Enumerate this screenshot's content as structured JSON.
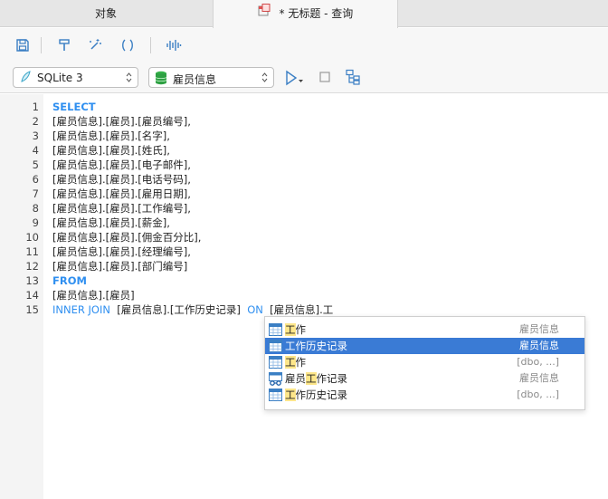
{
  "tabs": {
    "objects": "对象",
    "query": "* 无标题 - 查询"
  },
  "connection": {
    "database": "SQLite 3",
    "schema": "雇员信息"
  },
  "editor": {
    "lines": [
      {
        "n": "1",
        "parts": [
          {
            "t": "SELECT",
            "c": "kw"
          }
        ]
      },
      {
        "n": "2",
        "parts": [
          {
            "t": "[雇员信息].[雇员].[雇员编号],",
            "c": ""
          }
        ]
      },
      {
        "n": "3",
        "parts": [
          {
            "t": "[雇员信息].[雇员].[名字],",
            "c": ""
          }
        ]
      },
      {
        "n": "4",
        "parts": [
          {
            "t": "[雇员信息].[雇员].[姓氏],",
            "c": ""
          }
        ]
      },
      {
        "n": "5",
        "parts": [
          {
            "t": "[雇员信息].[雇员].[电子邮件],",
            "c": ""
          }
        ]
      },
      {
        "n": "6",
        "parts": [
          {
            "t": "[雇员信息].[雇员].[电话号码],",
            "c": ""
          }
        ]
      },
      {
        "n": "7",
        "parts": [
          {
            "t": "[雇员信息].[雇员].[雇用日期],",
            "c": ""
          }
        ]
      },
      {
        "n": "8",
        "parts": [
          {
            "t": "[雇员信息].[雇员].[工作编号],",
            "c": ""
          }
        ]
      },
      {
        "n": "9",
        "parts": [
          {
            "t": "[雇员信息].[雇员].[薪金],",
            "c": ""
          }
        ]
      },
      {
        "n": "10",
        "parts": [
          {
            "t": "[雇员信息].[雇员].[佣金百分比],",
            "c": ""
          }
        ]
      },
      {
        "n": "11",
        "parts": [
          {
            "t": "[雇员信息].[雇员].[经理编号],",
            "c": ""
          }
        ]
      },
      {
        "n": "12",
        "parts": [
          {
            "t": "[雇员信息].[雇员].[部门编号]",
            "c": ""
          }
        ]
      },
      {
        "n": "13",
        "parts": [
          {
            "t": "FROM",
            "c": "kw"
          }
        ]
      },
      {
        "n": "14",
        "parts": [
          {
            "t": "[雇员信息].[雇员]",
            "c": ""
          }
        ]
      },
      {
        "n": "15",
        "parts": [
          {
            "t": "INNER JOIN",
            "c": "kw2"
          },
          {
            "t": "  [雇员信息].[工作历史记录]  ",
            "c": ""
          },
          {
            "t": "ON",
            "c": "kw2"
          },
          {
            "t": "  [雇员信息].工",
            "c": ""
          }
        ]
      }
    ]
  },
  "autocomplete": {
    "items": [
      {
        "pre": "",
        "match": "工",
        "post": "作",
        "schema": "雇员信息",
        "icon": "table-icon",
        "selected": false
      },
      {
        "pre": "",
        "match": "工",
        "post": "作历史记录",
        "schema": "雇员信息",
        "icon": "table-icon",
        "selected": true
      },
      {
        "pre": "",
        "match": "工",
        "post": "作",
        "schema": "[dbo, ...]",
        "icon": "table-icon",
        "selected": false
      },
      {
        "pre": "雇员",
        "match": "工",
        "post": "作记录",
        "schema": "雇员信息",
        "icon": "view-icon",
        "selected": false
      },
      {
        "pre": "",
        "match": "工",
        "post": "作历史记录",
        "schema": "[dbo, ...]",
        "icon": "table-icon",
        "selected": false
      }
    ]
  },
  "colors": {
    "keyword": "#2f8ff0",
    "selection": "#3a7bd5",
    "match_highlight": "#fde68a"
  }
}
